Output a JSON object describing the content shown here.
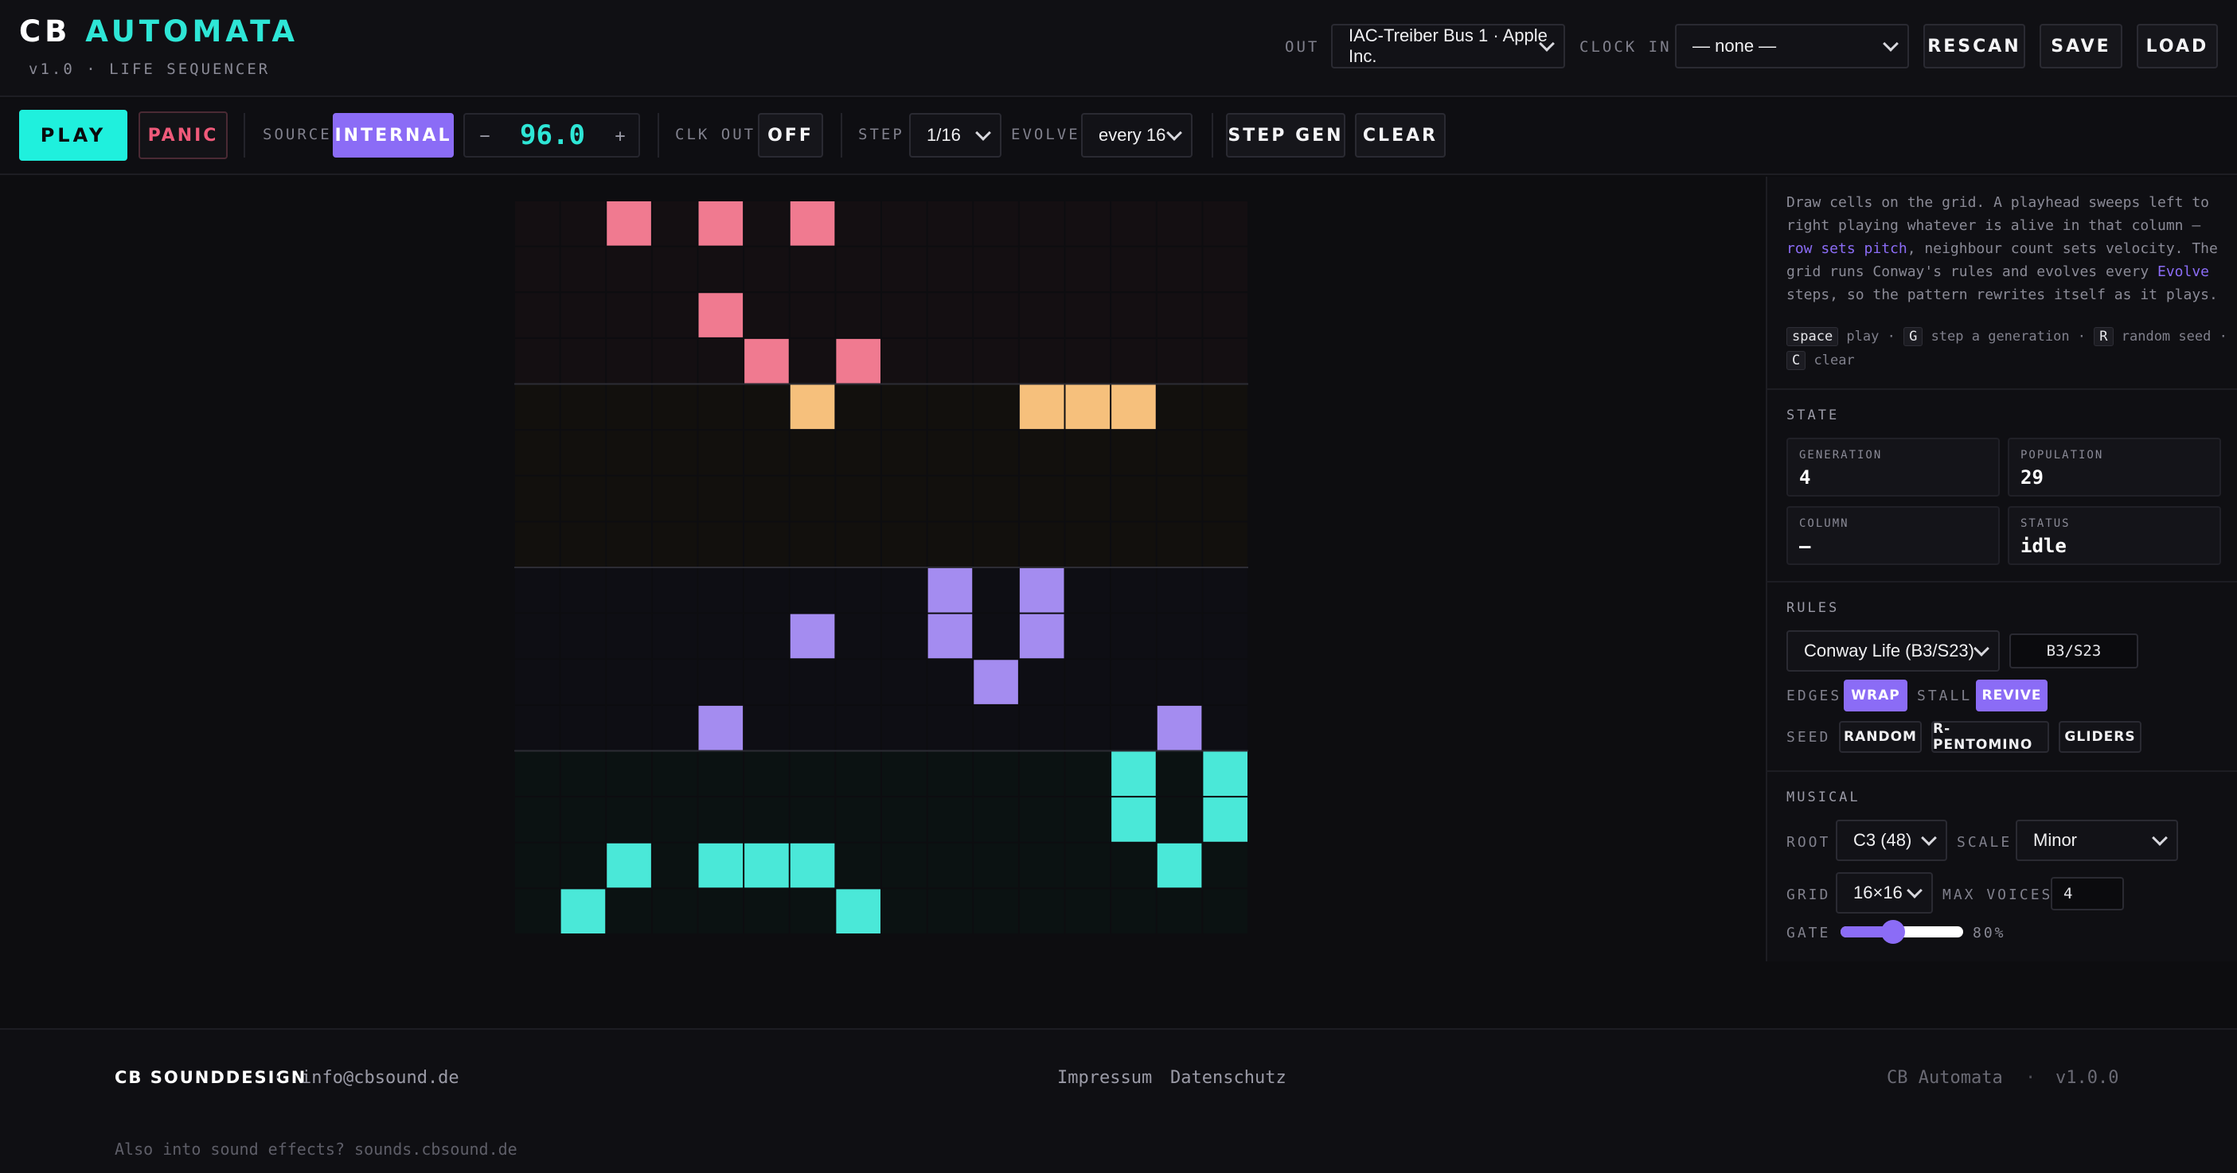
{
  "header": {
    "brand_part1": "CB",
    "brand_part2": "AUTOMATA",
    "version": "v1.0 · LIFE SEQUENCER",
    "out_label": "OUT",
    "out_device": "IAC-Treiber Bus 1 · Apple Inc.",
    "clock_in_label": "CLOCK IN",
    "clock_in_value": "— none —",
    "rescan_label": "RESCAN",
    "save_label": "SAVE",
    "load_label": "LOAD"
  },
  "toolbar": {
    "play_label": "PLAY",
    "panic_label": "PANIC",
    "source_label": "SOURCE",
    "source_value": "INTERNAL",
    "bpm_minus": "−",
    "bpm_value": "96.0",
    "bpm_plus": "+",
    "clk_out_label": "CLK OUT",
    "clk_out_value": "OFF",
    "step_label": "STEP",
    "step_value": "1/16",
    "evolve_label": "EVOLVE",
    "evolve_value": "every 16",
    "step_gen_label": "STEP GEN",
    "clear_label": "CLEAR"
  },
  "grid": {
    "rows": 16,
    "cols": 16,
    "band_colors": [
      "#f07a90",
      "#f6c07c",
      "#a48cf0",
      "#4ae8d8"
    ],
    "band_bg": [
      "#140f12",
      "#12100d",
      "#0e0e14",
      "#0b1212"
    ],
    "live_cells": [
      [
        0,
        2
      ],
      [
        0,
        4
      ],
      [
        0,
        6
      ],
      [
        2,
        4
      ],
      [
        3,
        5
      ],
      [
        3,
        7
      ],
      [
        4,
        6
      ],
      [
        4,
        11
      ],
      [
        4,
        12
      ],
      [
        4,
        13
      ],
      [
        8,
        9
      ],
      [
        8,
        11
      ],
      [
        9,
        6
      ],
      [
        9,
        9
      ],
      [
        9,
        11
      ],
      [
        10,
        10
      ],
      [
        11,
        4
      ],
      [
        11,
        14
      ],
      [
        12,
        13
      ],
      [
        12,
        15
      ],
      [
        13,
        13
      ],
      [
        13,
        15
      ],
      [
        14,
        2
      ],
      [
        14,
        4
      ],
      [
        14,
        5
      ],
      [
        14,
        6
      ],
      [
        14,
        14
      ],
      [
        15,
        1
      ],
      [
        15,
        7
      ]
    ]
  },
  "panel": {
    "desc_1": "Draw cells on the grid. A playhead sweeps left to right playing whatever is alive in that column — ",
    "desc_hl1": "row sets pitch",
    "desc_2": ", neighbour count sets velocity. The grid runs Conway's rules and evolves every ",
    "desc_hl2": "Evolve",
    "desc_3": " steps, so the pattern rewrites itself as it plays.",
    "key_space": "space",
    "key_space_desc": " play · ",
    "key_g": "G",
    "key_g_desc": " step a generation · ",
    "key_r": "R",
    "key_r_desc": " random seed · ",
    "key_c": "C",
    "key_c_desc": " clear",
    "state_title": "STATE",
    "generation_label": "GENERATION",
    "generation_value": "4",
    "population_label": "POPULATION",
    "population_value": "29",
    "column_label": "COLUMN",
    "column_value": "—",
    "status_label": "STATUS",
    "status_value": "idle",
    "rules_title": "RULES",
    "rule_select": "Conway Life (B3/S23)",
    "rule_code": "B3/S23",
    "edges_label": "EDGES",
    "edges_value": "WRAP",
    "stall_label": "STALL",
    "stall_value": "REVIVE",
    "seed_label": "SEED",
    "seed_random": "RANDOM",
    "seed_rpentomino": "R-PENTOMINO",
    "seed_gliders": "GLIDERS",
    "musical_title": "MUSICAL",
    "root_label": "ROOT",
    "root_value": "C3 (48)",
    "scale_label": "SCALE",
    "scale_value": "Minor",
    "grid_label": "GRID",
    "grid_value": "16×16",
    "max_voices_label": "MAX VOICES",
    "max_voices_value": "4",
    "gate_label": "GATE",
    "gate_value": "80%",
    "gate_fraction": 0.43
  },
  "footer": {
    "brand": "CB SOUNDDESIGN",
    "sep1": "·",
    "email": "info@cbsound.de",
    "impressum": "Impressum",
    "datenschutz": "Datenschutz",
    "app_name": "CB Automata",
    "sep2": "·",
    "app_version": "v1.0.0",
    "sfx_note": "Also into sound effects? sounds.cbsound.de"
  },
  "colors": {
    "accent_cyan": "#1ff0dd",
    "accent_purple": "#8b6cf6",
    "panic_red": "#ef5a7a"
  }
}
